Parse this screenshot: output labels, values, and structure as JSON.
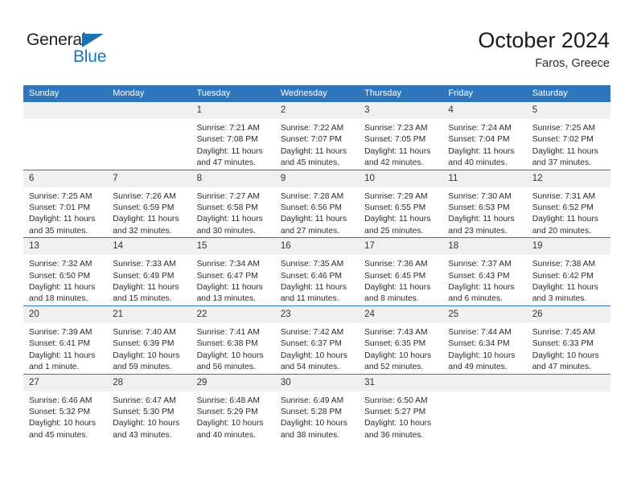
{
  "brand": {
    "name_part1": "General",
    "name_part2": "Blue",
    "triangle_color": "#1f6fb2",
    "blue_color": "#1b75bb"
  },
  "header": {
    "title": "October 2024",
    "location": "Faros, Greece"
  },
  "theme": {
    "header_blue": "#2f76ba",
    "daynum_band": "#f0f0f0",
    "text": "#2b2b2b"
  },
  "weekday_headers": [
    "Sunday",
    "Monday",
    "Tuesday",
    "Wednesday",
    "Thursday",
    "Friday",
    "Saturday"
  ],
  "weeks": [
    [
      {
        "day": "",
        "lines": []
      },
      {
        "day": "",
        "lines": []
      },
      {
        "day": "1",
        "lines": [
          "Sunrise: 7:21 AM",
          "Sunset: 7:08 PM",
          "Daylight: 11 hours",
          "and 47 minutes."
        ]
      },
      {
        "day": "2",
        "lines": [
          "Sunrise: 7:22 AM",
          "Sunset: 7:07 PM",
          "Daylight: 11 hours",
          "and 45 minutes."
        ]
      },
      {
        "day": "3",
        "lines": [
          "Sunrise: 7:23 AM",
          "Sunset: 7:05 PM",
          "Daylight: 11 hours",
          "and 42 minutes."
        ]
      },
      {
        "day": "4",
        "lines": [
          "Sunrise: 7:24 AM",
          "Sunset: 7:04 PM",
          "Daylight: 11 hours",
          "and 40 minutes."
        ]
      },
      {
        "day": "5",
        "lines": [
          "Sunrise: 7:25 AM",
          "Sunset: 7:02 PM",
          "Daylight: 11 hours",
          "and 37 minutes."
        ]
      }
    ],
    [
      {
        "day": "6",
        "lines": [
          "Sunrise: 7:25 AM",
          "Sunset: 7:01 PM",
          "Daylight: 11 hours",
          "and 35 minutes."
        ]
      },
      {
        "day": "7",
        "lines": [
          "Sunrise: 7:26 AM",
          "Sunset: 6:59 PM",
          "Daylight: 11 hours",
          "and 32 minutes."
        ]
      },
      {
        "day": "8",
        "lines": [
          "Sunrise: 7:27 AM",
          "Sunset: 6:58 PM",
          "Daylight: 11 hours",
          "and 30 minutes."
        ]
      },
      {
        "day": "9",
        "lines": [
          "Sunrise: 7:28 AM",
          "Sunset: 6:56 PM",
          "Daylight: 11 hours",
          "and 27 minutes."
        ]
      },
      {
        "day": "10",
        "lines": [
          "Sunrise: 7:29 AM",
          "Sunset: 6:55 PM",
          "Daylight: 11 hours",
          "and 25 minutes."
        ]
      },
      {
        "day": "11",
        "lines": [
          "Sunrise: 7:30 AM",
          "Sunset: 6:53 PM",
          "Daylight: 11 hours",
          "and 23 minutes."
        ]
      },
      {
        "day": "12",
        "lines": [
          "Sunrise: 7:31 AM",
          "Sunset: 6:52 PM",
          "Daylight: 11 hours",
          "and 20 minutes."
        ]
      }
    ],
    [
      {
        "day": "13",
        "lines": [
          "Sunrise: 7:32 AM",
          "Sunset: 6:50 PM",
          "Daylight: 11 hours",
          "and 18 minutes."
        ]
      },
      {
        "day": "14",
        "lines": [
          "Sunrise: 7:33 AM",
          "Sunset: 6:49 PM",
          "Daylight: 11 hours",
          "and 15 minutes."
        ]
      },
      {
        "day": "15",
        "lines": [
          "Sunrise: 7:34 AM",
          "Sunset: 6:47 PM",
          "Daylight: 11 hours",
          "and 13 minutes."
        ]
      },
      {
        "day": "16",
        "lines": [
          "Sunrise: 7:35 AM",
          "Sunset: 6:46 PM",
          "Daylight: 11 hours",
          "and 11 minutes."
        ]
      },
      {
        "day": "17",
        "lines": [
          "Sunrise: 7:36 AM",
          "Sunset: 6:45 PM",
          "Daylight: 11 hours",
          "and 8 minutes."
        ]
      },
      {
        "day": "18",
        "lines": [
          "Sunrise: 7:37 AM",
          "Sunset: 6:43 PM",
          "Daylight: 11 hours",
          "and 6 minutes."
        ]
      },
      {
        "day": "19",
        "lines": [
          "Sunrise: 7:38 AM",
          "Sunset: 6:42 PM",
          "Daylight: 11 hours",
          "and 3 minutes."
        ]
      }
    ],
    [
      {
        "day": "20",
        "lines": [
          "Sunrise: 7:39 AM",
          "Sunset: 6:41 PM",
          "Daylight: 11 hours",
          "and 1 minute."
        ]
      },
      {
        "day": "21",
        "lines": [
          "Sunrise: 7:40 AM",
          "Sunset: 6:39 PM",
          "Daylight: 10 hours",
          "and 59 minutes."
        ]
      },
      {
        "day": "22",
        "lines": [
          "Sunrise: 7:41 AM",
          "Sunset: 6:38 PM",
          "Daylight: 10 hours",
          "and 56 minutes."
        ]
      },
      {
        "day": "23",
        "lines": [
          "Sunrise: 7:42 AM",
          "Sunset: 6:37 PM",
          "Daylight: 10 hours",
          "and 54 minutes."
        ]
      },
      {
        "day": "24",
        "lines": [
          "Sunrise: 7:43 AM",
          "Sunset: 6:35 PM",
          "Daylight: 10 hours",
          "and 52 minutes."
        ]
      },
      {
        "day": "25",
        "lines": [
          "Sunrise: 7:44 AM",
          "Sunset: 6:34 PM",
          "Daylight: 10 hours",
          "and 49 minutes."
        ]
      },
      {
        "day": "26",
        "lines": [
          "Sunrise: 7:45 AM",
          "Sunset: 6:33 PM",
          "Daylight: 10 hours",
          "and 47 minutes."
        ]
      }
    ],
    [
      {
        "day": "27",
        "lines": [
          "Sunrise: 6:46 AM",
          "Sunset: 5:32 PM",
          "Daylight: 10 hours",
          "and 45 minutes."
        ]
      },
      {
        "day": "28",
        "lines": [
          "Sunrise: 6:47 AM",
          "Sunset: 5:30 PM",
          "Daylight: 10 hours",
          "and 43 minutes."
        ]
      },
      {
        "day": "29",
        "lines": [
          "Sunrise: 6:48 AM",
          "Sunset: 5:29 PM",
          "Daylight: 10 hours",
          "and 40 minutes."
        ]
      },
      {
        "day": "30",
        "lines": [
          "Sunrise: 6:49 AM",
          "Sunset: 5:28 PM",
          "Daylight: 10 hours",
          "and 38 minutes."
        ]
      },
      {
        "day": "31",
        "lines": [
          "Sunrise: 6:50 AM",
          "Sunset: 5:27 PM",
          "Daylight: 10 hours",
          "and 36 minutes."
        ]
      },
      {
        "day": "",
        "lines": []
      },
      {
        "day": "",
        "lines": []
      }
    ]
  ]
}
